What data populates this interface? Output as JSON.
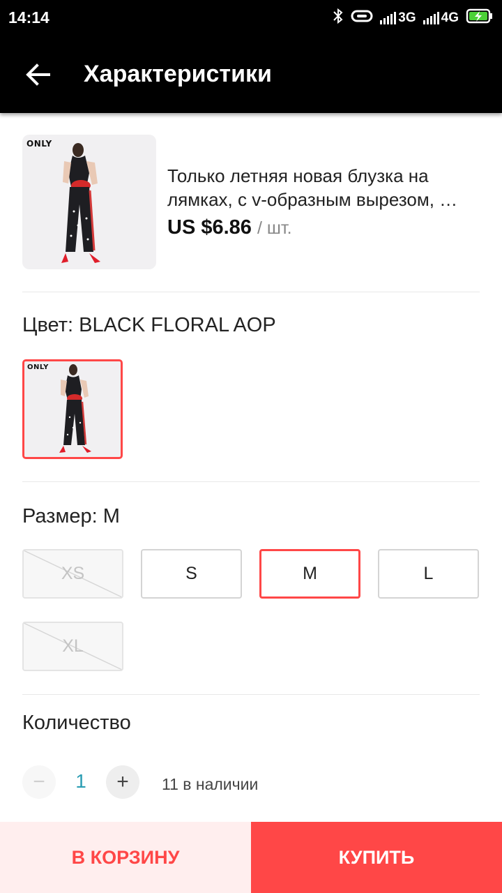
{
  "status_bar": {
    "time": "14:14",
    "network_1": "3G",
    "network_2": "4G",
    "icons": [
      "bluetooth-icon",
      "link-icon",
      "signal-icon",
      "signal-icon",
      "battery-charging-icon"
    ]
  },
  "app_bar": {
    "title": "Характеристики",
    "back_icon": "arrow-left-icon"
  },
  "product": {
    "brand": "ONLY",
    "title": "Только летняя новая блузка на лямках, с v-образным вырезом, …",
    "price": "US $6.86",
    "unit": "/ шт."
  },
  "color": {
    "label": "Цвет: BLACK FLORAL AOP",
    "swatch_brand": "ONLY"
  },
  "size": {
    "label": "Размер: M",
    "options": [
      {
        "label": "XS",
        "state": "disabled"
      },
      {
        "label": "S",
        "state": "available"
      },
      {
        "label": "M",
        "state": "selected"
      },
      {
        "label": "L",
        "state": "available"
      },
      {
        "label": "XL",
        "state": "disabled"
      }
    ]
  },
  "quantity": {
    "label": "Количество",
    "minus": "−",
    "value": "1",
    "plus": "+",
    "stock": "11 в наличии"
  },
  "actions": {
    "add_to_cart": "В КОРЗИНУ",
    "buy": "КУПИТЬ"
  },
  "colors": {
    "accent": "#ff4747",
    "accent_light": "#ffeeee",
    "bar": "#000000",
    "qty_value": "#2a9db3"
  }
}
